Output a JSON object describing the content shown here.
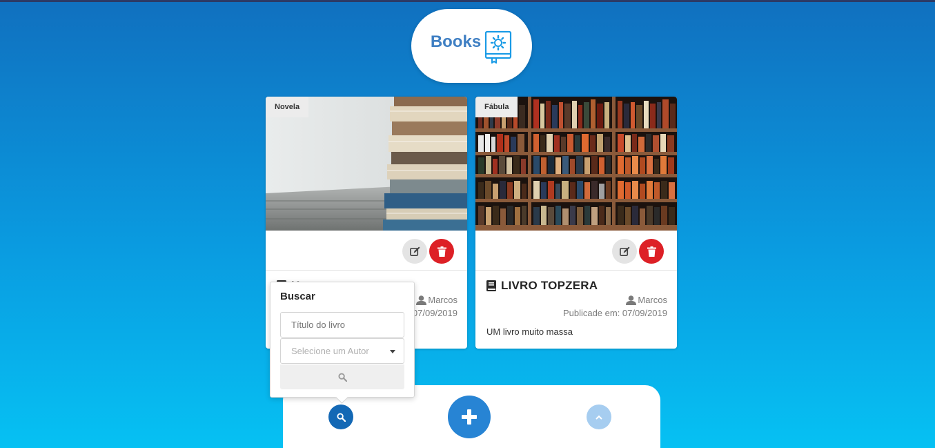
{
  "app": {
    "logo_text": "Books",
    "logo_icon": "book-gear-icon"
  },
  "cards": [
    {
      "category": "Novela",
      "title": "Um",
      "author": "Marcos",
      "published": "Publicade em: 07/09/2019",
      "description": "",
      "image": "stacked-books-photo"
    },
    {
      "category": "Fábula",
      "title": "LIVRO TOPZERA",
      "author": "Marcos",
      "published": "Publicade em: 07/09/2019",
      "description": "UM livro muito massa",
      "image": "bookshelf-photo"
    }
  ],
  "search": {
    "title": "Buscar",
    "title_placeholder": "Título do livro",
    "author_placeholder": "Selecione um Autor"
  },
  "colors": {
    "accent": "#2784d4",
    "danger": "#dd2026",
    "logo_text": "#3f7fc3"
  }
}
